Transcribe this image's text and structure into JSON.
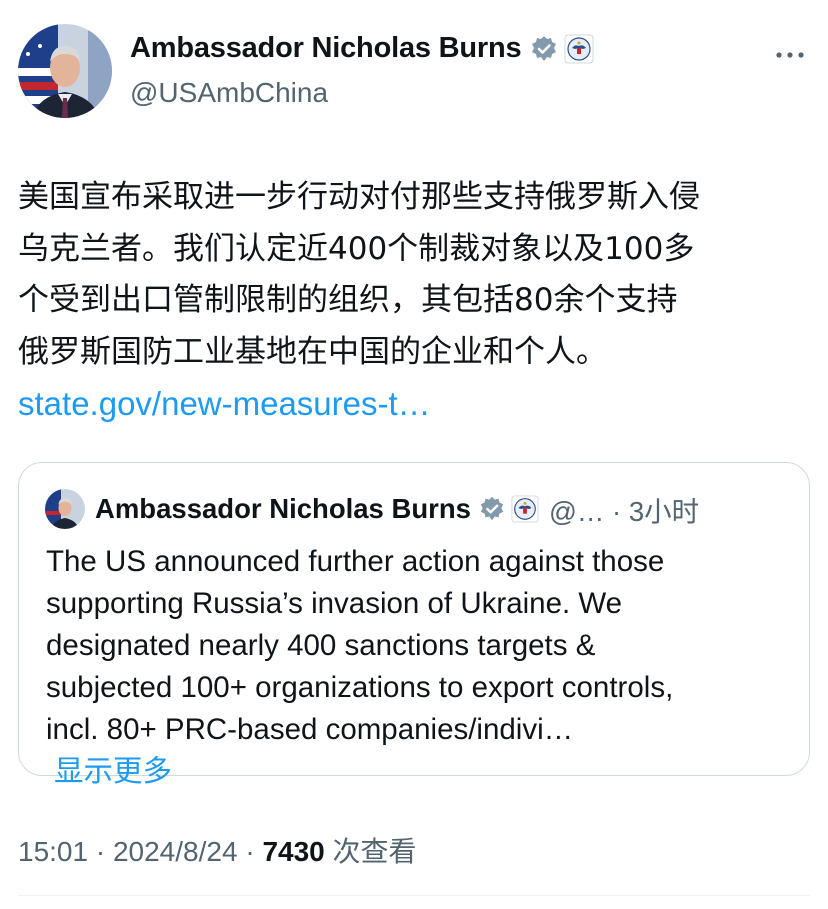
{
  "author": {
    "name": "Ambassador Nicholas Burns",
    "handle": "@USAmbChina"
  },
  "tweet": {
    "text_lines": [
      "美国宣布采取进一步行动对付那些支持俄罗斯入侵",
      "乌克兰者。我们认定近400个制裁对象以及100多",
      "个受到出口管制限制的组织，其包括80余个支持",
      "俄罗斯国防工业基地在中国的企业和个人。"
    ],
    "link": "state.gov/new-measures-t…"
  },
  "quote": {
    "name": "Ambassador Nicholas Burns",
    "handle": "@…",
    "separator": "·",
    "time": "3小时",
    "text_lines": [
      "The US announced further action against those",
      "supporting Russia’s invasion of Ukraine. We",
      "designated nearly 400 sanctions targets &",
      "subjected 100+ organizations to export controls,",
      "incl. 80+ PRC-based companies/indivi…"
    ],
    "show_more": "显示更多"
  },
  "footer": {
    "time": "15:01",
    "date": "2024/8/24",
    "separator": "·",
    "views_count": "7430",
    "views_label": "次查看"
  },
  "colors": {
    "accent": "#1d9bf0",
    "secondary_text": "#536471",
    "border": "#cfd9de"
  },
  "icons": {
    "verified": "gray-verified-badge-icon",
    "affiliation": "us-state-department-seal-icon",
    "more": "more-horizontal-icon"
  }
}
